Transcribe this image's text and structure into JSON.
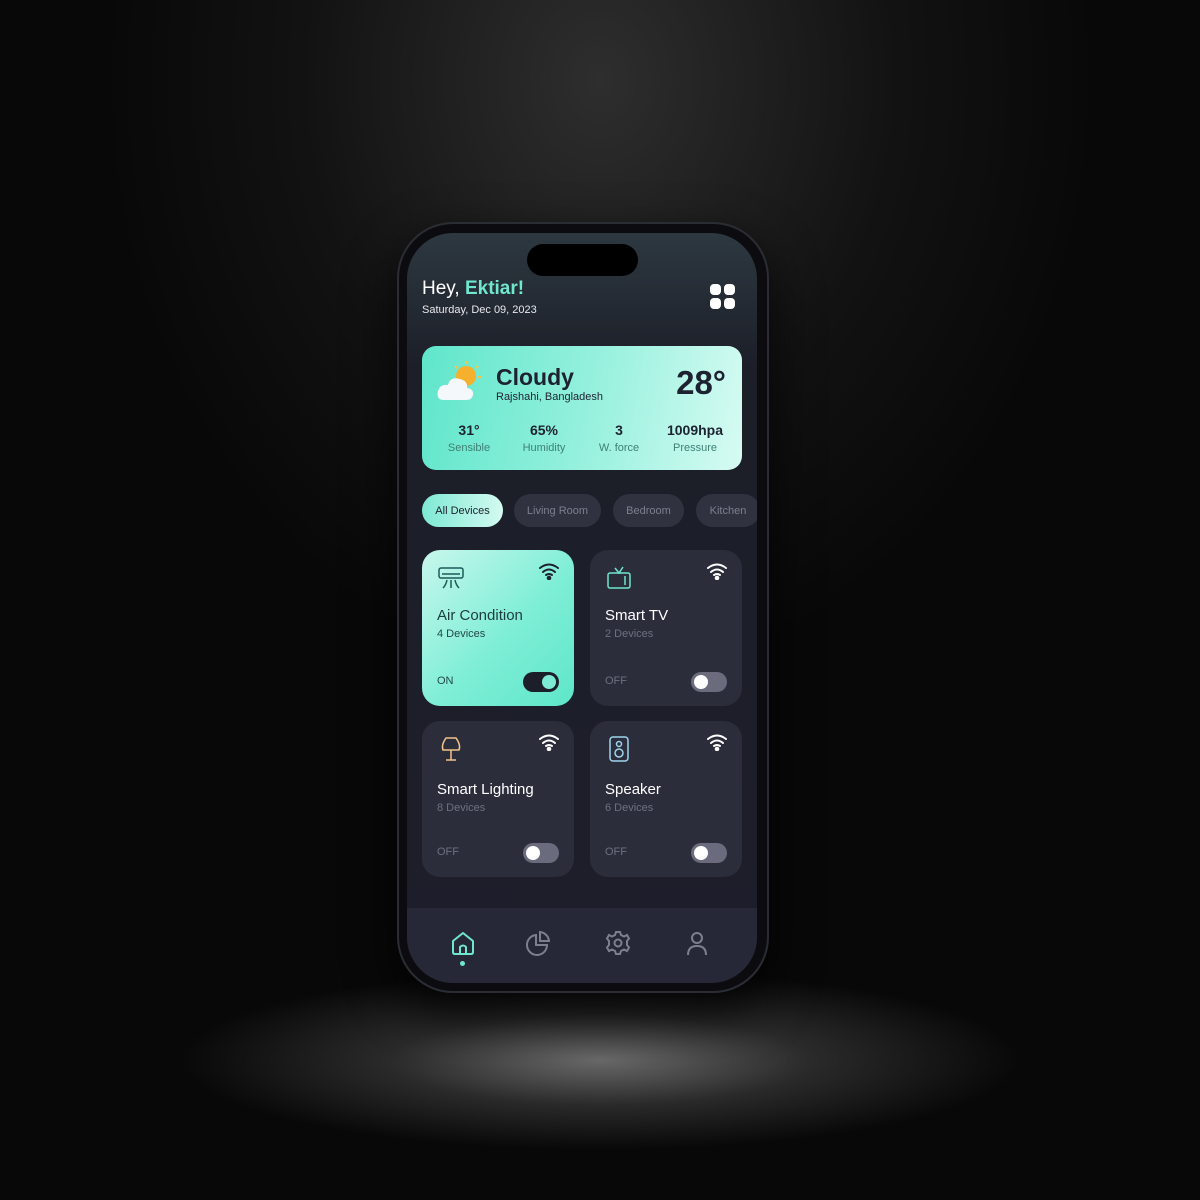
{
  "header": {
    "greeting": "Hey,",
    "name": "Ektiar!",
    "date": "Saturday, Dec 09, 2023"
  },
  "weather": {
    "condition": "Cloudy",
    "location": "Rajshahi, Bangladesh",
    "temperature": "28°",
    "stats": [
      {
        "value": "31°",
        "label": "Sensible"
      },
      {
        "value": "65%",
        "label": "Humidity"
      },
      {
        "value": "3",
        "label": "W. force"
      },
      {
        "value": "1009hpa",
        "label": "Pressure"
      }
    ]
  },
  "filters": [
    {
      "label": "All Devices",
      "active": true
    },
    {
      "label": "Living Room"
    },
    {
      "label": "Bedroom"
    },
    {
      "label": "Kitchen"
    }
  ],
  "devices": [
    {
      "name": "Air Condition",
      "count": "4 Devices",
      "state": "ON",
      "on": true,
      "icon": "air-conditioner-icon"
    },
    {
      "name": "Smart TV",
      "count": "2 Devices",
      "state": "OFF",
      "on": false,
      "icon": "tv-icon"
    },
    {
      "name": "Smart Lighting",
      "count": "8 Devices",
      "state": "OFF",
      "on": false,
      "icon": "lamp-icon"
    },
    {
      "name": "Speaker",
      "count": "6 Devices",
      "state": "OFF",
      "on": false,
      "icon": "speaker-icon"
    }
  ],
  "nav": [
    {
      "icon": "home-icon",
      "active": true
    },
    {
      "icon": "chart-icon"
    },
    {
      "icon": "settings-icon"
    },
    {
      "icon": "profile-icon"
    }
  ],
  "colors": {
    "accent": "#6fe6cd",
    "card": "#2c2d3b",
    "background": "#1d1e2b"
  }
}
